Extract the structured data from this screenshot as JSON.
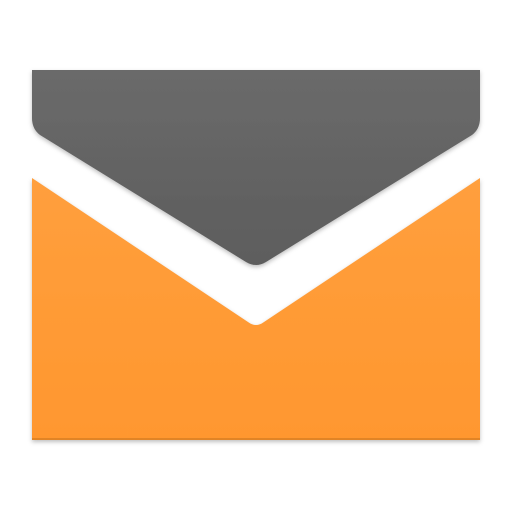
{
  "icon": {
    "name": "envelope-icon",
    "colors": {
      "flap": "#636363",
      "body": "#FF9A35",
      "background": "#FFFFFF"
    }
  }
}
